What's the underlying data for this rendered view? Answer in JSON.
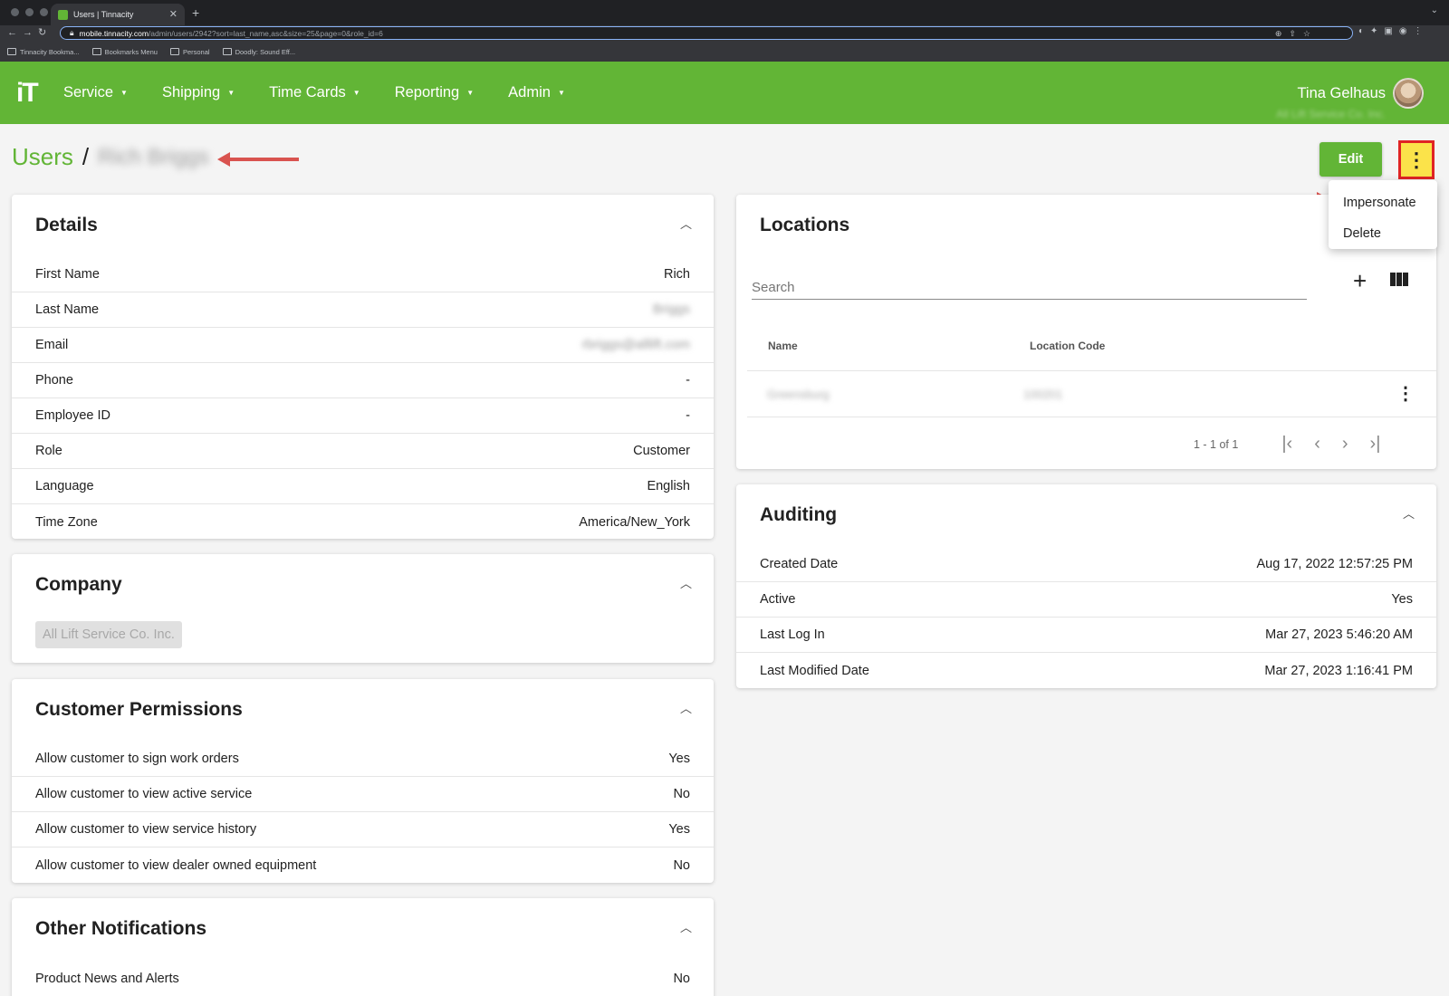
{
  "browser": {
    "tab_title": "Users | Tinnacity",
    "url_host": "mobile.tinnacity.com",
    "url_path": "/admin/users/2942?sort=last_name,asc&size=25&page=0&role_id=6",
    "bookmarks": [
      "Tinnacity Bookma...",
      "Bookmarks Menu",
      "Personal",
      "Doodly: Sound Eff..."
    ]
  },
  "header": {
    "logo": "iT",
    "nav": [
      "Service",
      "Shipping",
      "Time Cards",
      "Reporting",
      "Admin"
    ],
    "user_name": "Tina Gelhaus",
    "user_company": "All Lift Service Co. Inc."
  },
  "page": {
    "breadcrumb_root": "Users",
    "breadcrumb_sep": "/",
    "user_display_name": "Rich Briggs",
    "edit_label": "Edit",
    "menu": [
      "Impersonate",
      "Delete"
    ]
  },
  "details": {
    "title": "Details",
    "rows": [
      {
        "label": "First Name",
        "value": "Rich"
      },
      {
        "label": "Last Name",
        "value": "Briggs"
      },
      {
        "label": "Email",
        "value": "rbriggs@alllift.com"
      },
      {
        "label": "Phone",
        "value": "-"
      },
      {
        "label": "Employee ID",
        "value": "-"
      },
      {
        "label": "Role",
        "value": "Customer"
      },
      {
        "label": "Language",
        "value": "English"
      },
      {
        "label": "Time Zone",
        "value": "America/New_York"
      }
    ]
  },
  "company": {
    "title": "Company",
    "chip": "All Lift Service Co. Inc."
  },
  "permissions": {
    "title": "Customer Permissions",
    "rows": [
      {
        "label": "Allow customer to sign work orders",
        "value": "Yes"
      },
      {
        "label": "Allow customer to view active service",
        "value": "No"
      },
      {
        "label": "Allow customer to view service history",
        "value": "Yes"
      },
      {
        "label": "Allow customer to view dealer owned equipment",
        "value": "No"
      }
    ]
  },
  "notifications": {
    "title": "Other Notifications",
    "rows": [
      {
        "label": "Product News and Alerts",
        "value": "No"
      }
    ]
  },
  "locations": {
    "title": "Locations",
    "search_placeholder": "Search",
    "columns": [
      "Name",
      "Location Code"
    ],
    "rows": [
      {
        "name": "Greensburg",
        "code": "100201"
      }
    ],
    "pagination": "1 - 1 of 1"
  },
  "auditing": {
    "title": "Auditing",
    "rows": [
      {
        "label": "Created Date",
        "value": "Aug 17, 2022 12:57:25 PM"
      },
      {
        "label": "Active",
        "value": "Yes"
      },
      {
        "label": "Last Log In",
        "value": "Mar 27, 2023 5:46:20 AM"
      },
      {
        "label": "Last Modified Date",
        "value": "Mar 27, 2023 1:16:41 PM"
      }
    ]
  },
  "colors": {
    "brand_green": "#62b536",
    "annotation_red": "#d9534f",
    "highlight_yellow": "#fbe34a"
  }
}
